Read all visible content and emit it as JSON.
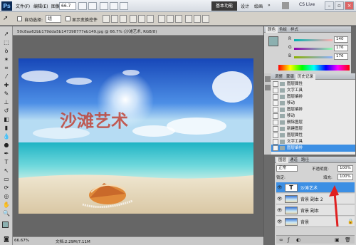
{
  "app": {
    "logo": "Ps"
  },
  "menus": [
    "文件(F)",
    "编辑(E)",
    "图像(I)",
    "图层(L)",
    "选择(S)",
    "滤镜(T)",
    "分析(A)",
    "3D(D)",
    "视图(V)",
    "窗口(W)",
    "帮助(H)"
  ],
  "zoom_select": "66.7",
  "workspace": {
    "active": "基本功能",
    "others": [
      "设计",
      "绘画",
      "»"
    ]
  },
  "cs_live": "CS Live",
  "options_bar": {
    "auto_select_label": "自动选择:",
    "auto_select_value": "组",
    "show_transform_label": "显示变换控件"
  },
  "document": {
    "tab_label": "50c8aa62bb179dda5b147398777eb149.jpg @ 66.7% (沙滩艺术, RGB/8)",
    "canvas_text": "沙滩艺术",
    "zoom_status": "66.67%",
    "doc_status": "文档:2.29M/7.11M"
  },
  "color_panel": {
    "tabs": [
      "颜色",
      "色板",
      "样式"
    ],
    "sliders": [
      {
        "label": "R",
        "value": "140"
      },
      {
        "label": "G",
        "value": "176"
      },
      {
        "label": "B",
        "value": "176"
      }
    ]
  },
  "history_panel": {
    "tabs": [
      "调整",
      "蒙版",
      "历史记录"
    ],
    "items": [
      "图层属性",
      "文字工具",
      "图层编排",
      "移动",
      "图层编排",
      "移动",
      "删除图层",
      "新建图层",
      "图层属性",
      "文字工具",
      "图层编排"
    ],
    "selected_index": 10
  },
  "layers_panel": {
    "tabs": [
      "图层",
      "通道",
      "路径"
    ],
    "blend_mode": "正常",
    "opacity_label": "不透明度:",
    "opacity": "100%",
    "lock_label": "锁定:",
    "fill_label": "填充:",
    "fill": "100%",
    "layers": [
      {
        "name": "沙滩艺术",
        "type": "text",
        "selected": true
      },
      {
        "name": "背景 副本 2",
        "type": "image",
        "selected": false
      },
      {
        "name": "背景 副本",
        "type": "image",
        "selected": false
      },
      {
        "name": "背景",
        "type": "image",
        "selected": false
      }
    ]
  },
  "colors": {
    "selection": "#3c8fe4",
    "canvas_text": "#c0392b",
    "ps_logo_bg": "#0b2a55"
  }
}
